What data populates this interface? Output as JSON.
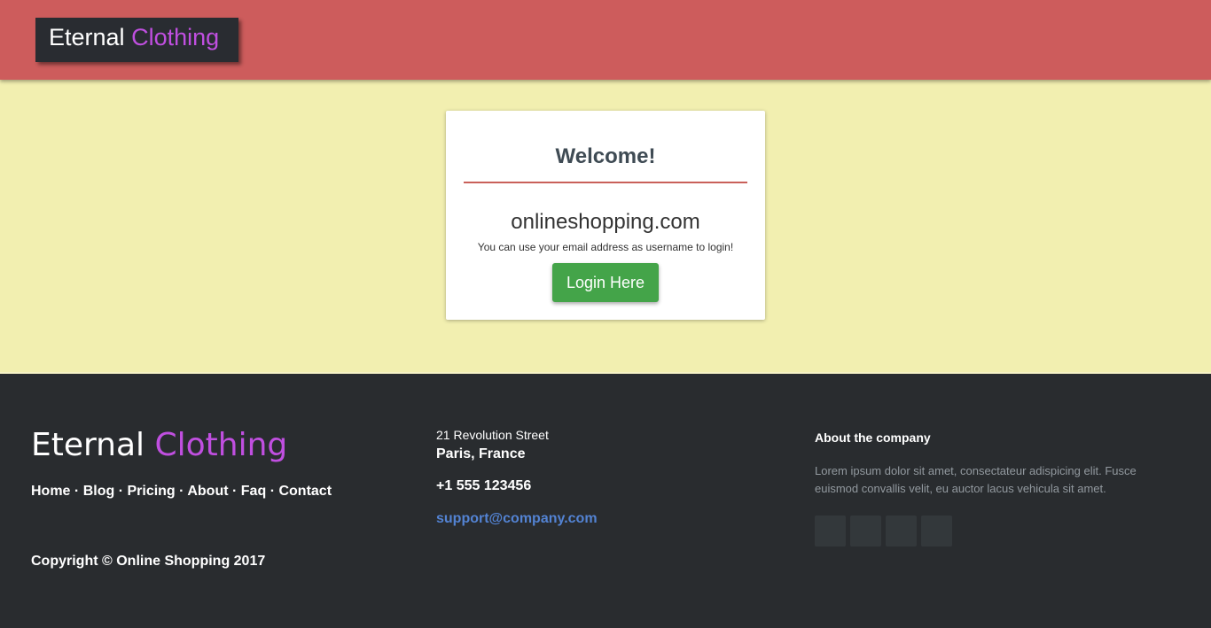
{
  "header": {
    "logo_main": "Eternal",
    "logo_accent": "Clothing"
  },
  "card": {
    "title": "Welcome!",
    "site": "onlineshopping.com",
    "hint": "You can use your email address as username to login!",
    "login_label": "Login Here"
  },
  "footer": {
    "brand_main": "Eternal",
    "brand_accent": "Clothing",
    "links": [
      "Home",
      "Blog",
      "Pricing",
      "About",
      "Faq",
      "Contact"
    ],
    "separator": "·",
    "copyright": "Copyright © Online Shopping 2017",
    "street": "21 Revolution Street",
    "city": "Paris, France",
    "phone": "+1 555 123456",
    "email": "support@company.com",
    "about_heading": "About the company",
    "about_text": "Lorem ipsum dolor sit amet, consectateur adispicing elit. Fusce euismod convallis velit, eu auctor lacus vehicula sit amet."
  },
  "colors": {
    "header_bg": "#cd5c5c",
    "logo_bg": "#292c31",
    "accent": "#c04fe0",
    "page_bg": "#f2efb0",
    "footer_bg": "#292c2f",
    "button_green": "#44a449",
    "email_link": "#5383d3"
  }
}
